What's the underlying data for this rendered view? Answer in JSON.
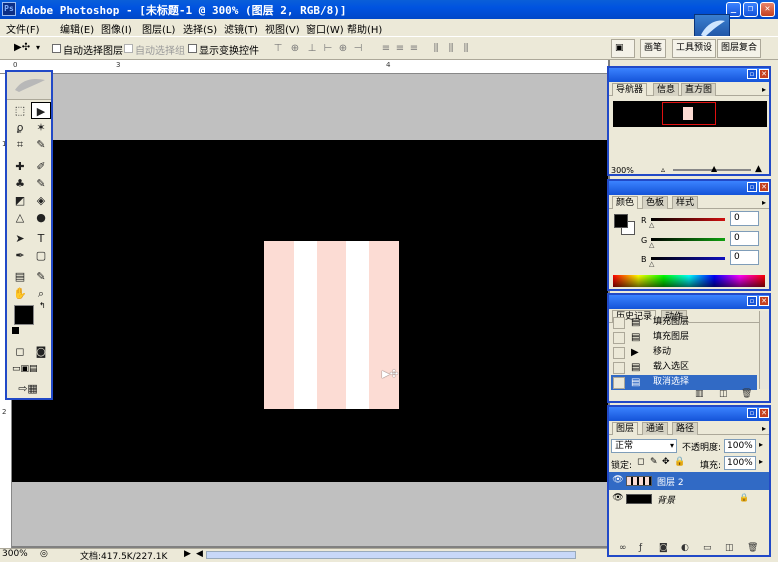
{
  "window": {
    "title": "Adobe Photoshop - [未标题-1 @ 300% (图层 2, RGB/8)]",
    "app_icon": "Ps",
    "minimize_glyph": "_",
    "maximize_glyph": "❐",
    "close_glyph": "✕"
  },
  "menu": [
    "文件(F)",
    "编辑(E)",
    "图像(I)",
    "图层(L)",
    "选择(S)",
    "滤镜(T)",
    "视图(V)",
    "窗口(W)",
    "帮助(H)"
  ],
  "options": {
    "tool_glyph": "▶✣",
    "auto_select_layer": "自动选择图层",
    "auto_select_group": "自动选择组",
    "show_transform": "显示变换控件",
    "well_tabs": [
      "画笔",
      "工具预设",
      "图层复合"
    ]
  },
  "rulers": {
    "h": [
      "0",
      "3",
      "4"
    ],
    "v": [
      "1",
      "2"
    ]
  },
  "canvas": {
    "stripe_colors": [
      "#fcdcd4",
      "#ffffff",
      "#fcdcd4",
      "#ffffff",
      "#fcdcd4"
    ],
    "cursor": "▶✣"
  },
  "status": {
    "zoom": "300%",
    "doc": "文档:417.5K/227.1K",
    "nav_arrow": "▶",
    "scroll_left": "◀"
  },
  "navigator": {
    "tabs": [
      "导航器",
      "信息",
      "直方图"
    ],
    "zoom": "300%"
  },
  "color": {
    "tabs": [
      "颜色",
      "色板",
      "样式"
    ],
    "channels": [
      {
        "label": "R",
        "value": "0",
        "color": "#d01010"
      },
      {
        "label": "G",
        "value": "0",
        "color": "#10a010"
      },
      {
        "label": "B",
        "value": "0",
        "color": "#1010c0"
      }
    ]
  },
  "history": {
    "tabs": [
      "历史记录",
      "动作"
    ],
    "items": [
      {
        "label": "填充图层",
        "icon": "▤"
      },
      {
        "label": "填充图层",
        "icon": "▤"
      },
      {
        "label": "移动",
        "icon": "▶"
      },
      {
        "label": "载入选区",
        "icon": "▤"
      },
      {
        "label": "取消选择",
        "icon": "▤"
      }
    ]
  },
  "layers": {
    "tabs": [
      "图层",
      "通道",
      "路径"
    ],
    "blend_mode": "正常",
    "opacity_label": "不透明度:",
    "opacity": "100%",
    "lock_label": "锁定:",
    "fill_label": "填充:",
    "fill": "100%",
    "rows": [
      {
        "name": "图层 2",
        "selected": true
      },
      {
        "name": "背景",
        "selected": false
      }
    ],
    "footer_icons": [
      "link-icon",
      "style-icon",
      "mask-icon",
      "adjust-icon",
      "folder-icon",
      "new-layer-icon",
      "trash-icon"
    ]
  }
}
